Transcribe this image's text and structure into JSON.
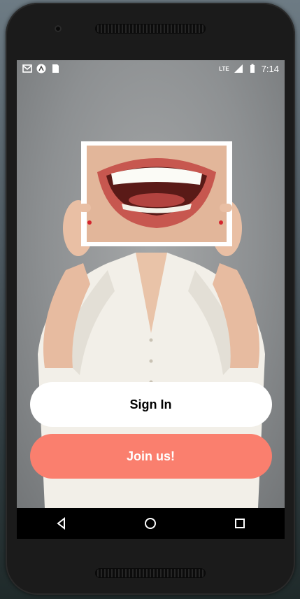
{
  "status_bar": {
    "left_icons": [
      "gmail-icon",
      "expo-icon",
      "sd-card-icon"
    ],
    "network": "LTE",
    "time": "7:14"
  },
  "buttons": {
    "sign_in": "Sign In",
    "join": "Join us!"
  },
  "nav_bar": {
    "icons": [
      "back-icon",
      "home-icon",
      "recents-icon"
    ]
  },
  "colors": {
    "join_button": "#fa7f6e",
    "sign_in_button": "#ffffff",
    "nav_bar": "#000000"
  }
}
